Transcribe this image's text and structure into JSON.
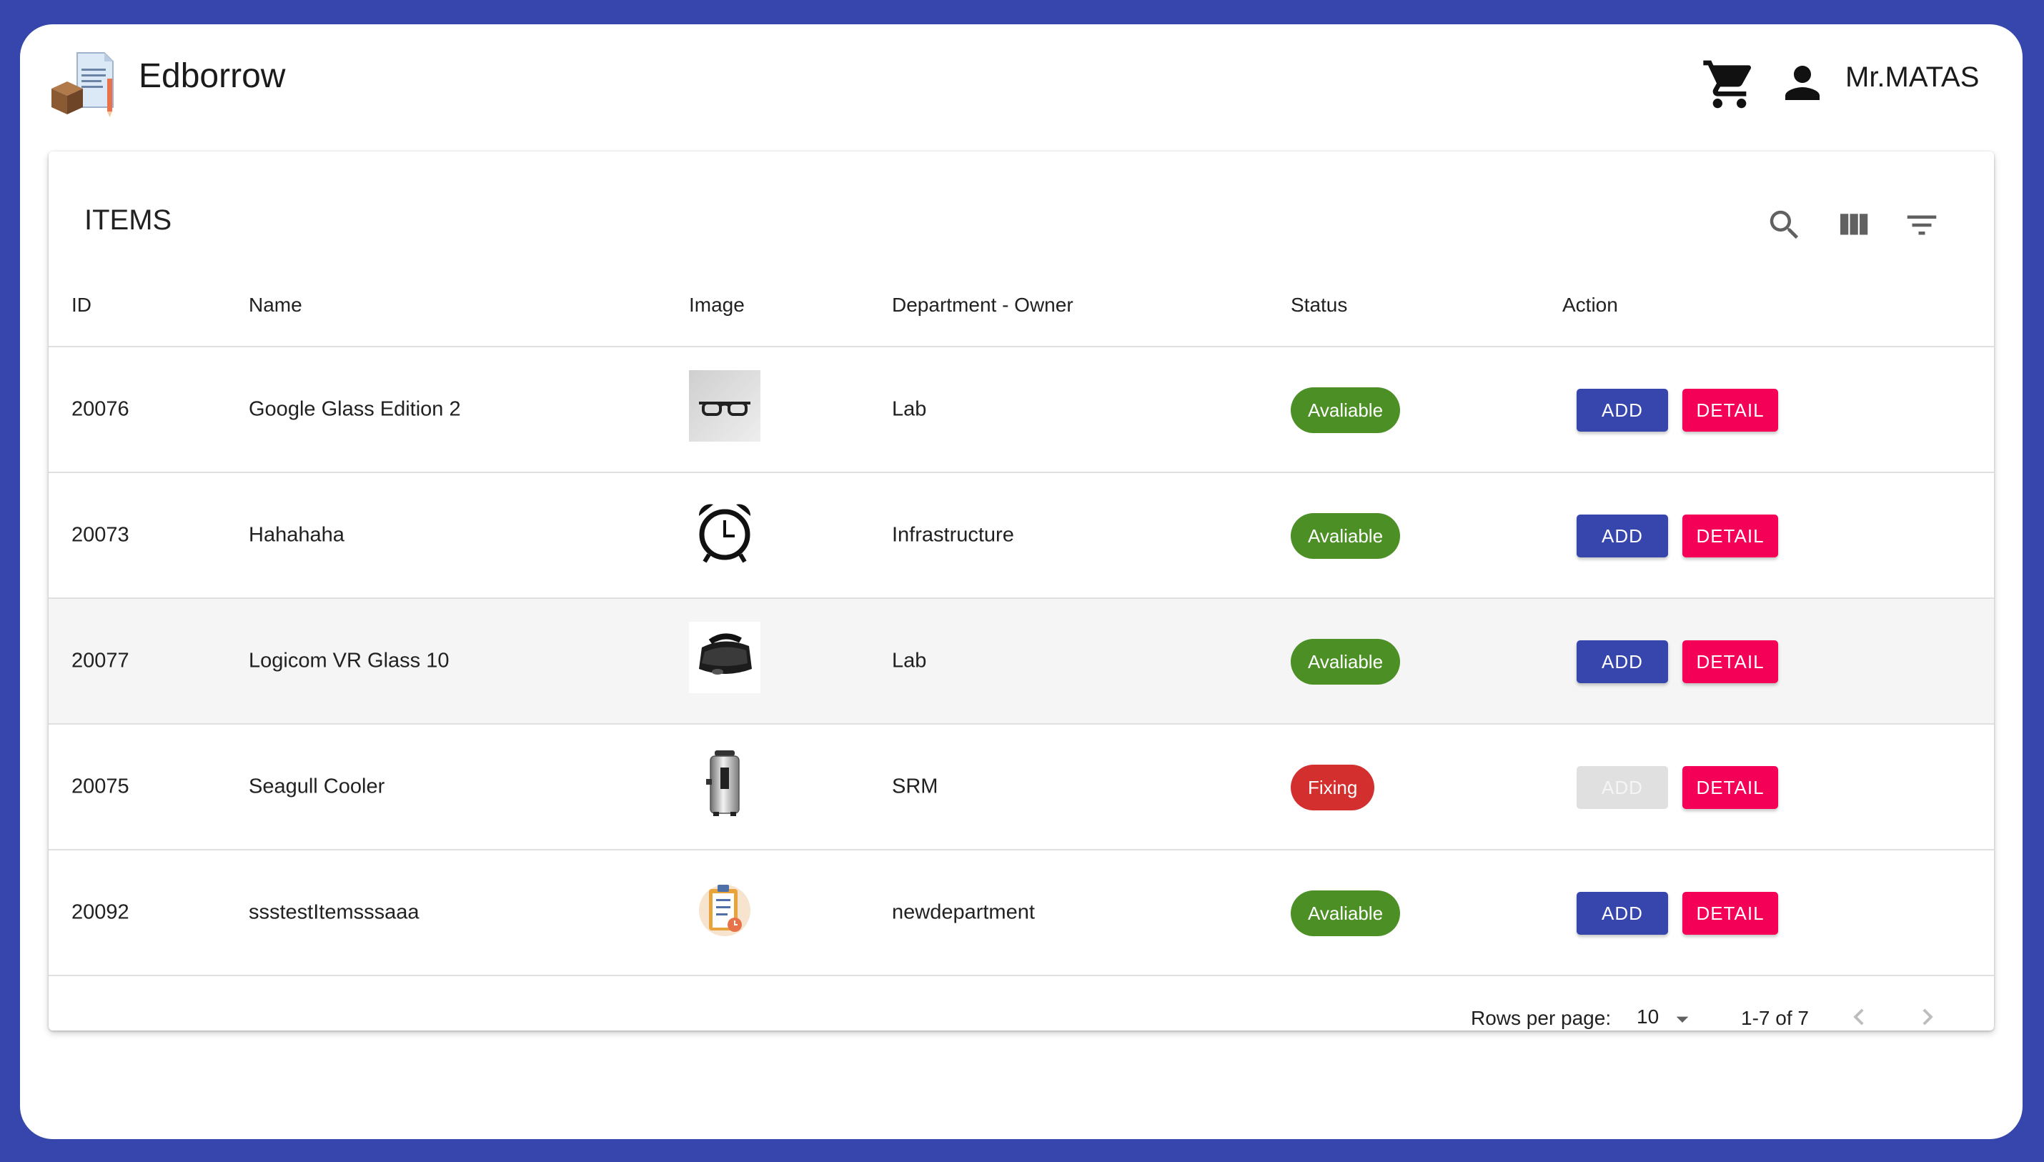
{
  "app": {
    "title": "Edborrow",
    "user_name": "Mr.MATAS",
    "icons": {
      "logo": "document-box-pencil-logo",
      "cart": "cart-icon",
      "user": "person-icon"
    }
  },
  "table": {
    "title": "ITEMS",
    "toolbar_icons": [
      "search-icon",
      "view-column-icon",
      "filter-list-icon"
    ],
    "headers": {
      "id": "ID",
      "name": "Name",
      "image": "Image",
      "department": "Department - Owner",
      "status": "Status",
      "action": "Action"
    },
    "rows": [
      {
        "id": "20076",
        "name": "Google Glass Edition 2",
        "image": "smart-glasses",
        "department": "Lab",
        "status": "Avaliable",
        "add": "ADD",
        "detail": "DETAIL"
      },
      {
        "id": "20073",
        "name": "Hahahaha",
        "image": "alarm-clock",
        "department": "Infrastructure",
        "status": "Avaliable",
        "add": "ADD",
        "detail": "DETAIL"
      },
      {
        "id": "20077",
        "name": "Logicom VR Glass 10",
        "image": "vr-headset",
        "department": "Lab",
        "status": "Avaliable",
        "add": "ADD",
        "detail": "DETAIL"
      },
      {
        "id": "20075",
        "name": "Seagull Cooler",
        "image": "water-boiler",
        "department": "SRM",
        "status": "Fixing",
        "add": "ADD",
        "detail": "DETAIL"
      },
      {
        "id": "20092",
        "name": "ssstestItemsssaaa",
        "image": "clipboard-checklist",
        "department": "newdepartment",
        "status": "Avaliable",
        "add": "ADD",
        "detail": "DETAIL"
      }
    ],
    "footer": {
      "rows_per_page_label": "Rows per page:",
      "rows_per_page_value": "10",
      "range": "1-7 of 7"
    }
  },
  "colors": {
    "background": "#3646ad",
    "primary": "#3646ad",
    "secondary": "#f50057",
    "status_available": "#4b8f25",
    "status_fixing": "#d32f2f"
  }
}
